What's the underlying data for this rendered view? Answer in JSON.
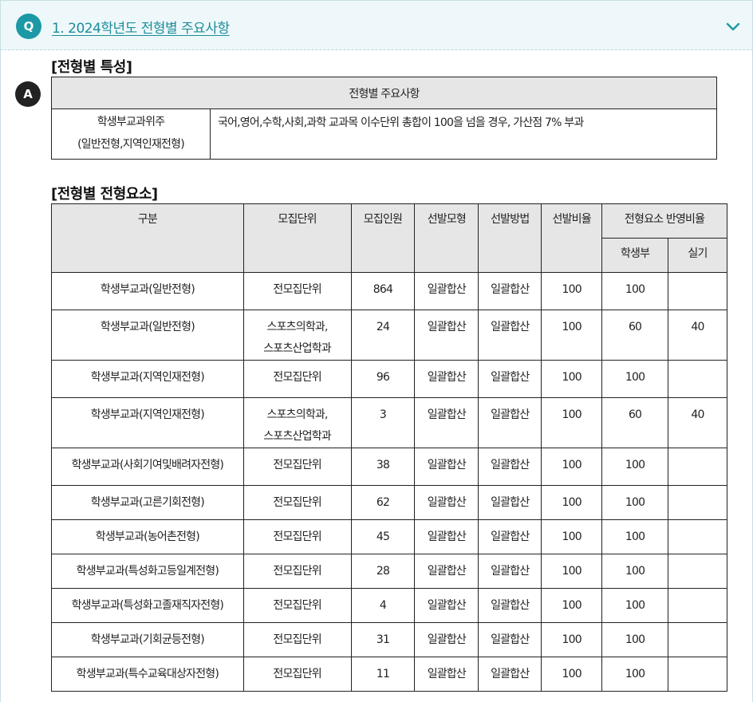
{
  "question": {
    "badge": "Q",
    "title": "1. 2024학년도 전형별 주요사항"
  },
  "answer": {
    "badge": "A"
  },
  "section1": {
    "title": "[전형별 특성]",
    "header": "전형별 주요사항",
    "row": {
      "label_line1": "학생부교과위주",
      "label_line2": "(일반전형,지역인재전형)",
      "content": "국어,영어,수학,사회,과학 교과목 이수단위 총합이 100을 넘을 경우, 가산점 7% 부과"
    }
  },
  "section2": {
    "title": "[전형별 전형요소]",
    "headers": {
      "category": "구분",
      "unit": "모집단위",
      "count": "모집인원",
      "model": "선발모형",
      "method": "선발방법",
      "ratio": "선발비율",
      "reflect": "전형요소 반영비율",
      "record": "학생부",
      "practical": "실기"
    },
    "rows": [
      {
        "category": "학생부교과(일반전형)",
        "unit1": "전모집단위",
        "unit2": "",
        "count": "864",
        "model": "일괄합산",
        "method": "일괄합산",
        "ratio": "100",
        "record": "100",
        "practical": ""
      },
      {
        "category": "학생부교과(일반전형)",
        "unit1": "스포츠의학과,",
        "unit2": "스포츠산업학과",
        "count": "24",
        "model": "일괄합산",
        "method": "일괄합산",
        "ratio": "100",
        "record": "60",
        "practical": "40"
      },
      {
        "category": "학생부교과(지역인재전형)",
        "unit1": "전모집단위",
        "unit2": "",
        "count": "96",
        "model": "일괄합산",
        "method": "일괄합산",
        "ratio": "100",
        "record": "100",
        "practical": ""
      },
      {
        "category": "학생부교과(지역인재전형)",
        "unit1": "스포츠의학과,",
        "unit2": "스포츠산업학과",
        "count": "3",
        "model": "일괄합산",
        "method": "일괄합산",
        "ratio": "100",
        "record": "60",
        "practical": "40"
      },
      {
        "category": "학생부교과(사회기여및배려자전형)",
        "unit1": "전모집단위",
        "unit2": "",
        "count": "38",
        "model": "일괄합산",
        "method": "일괄합산",
        "ratio": "100",
        "record": "100",
        "practical": ""
      },
      {
        "category": "학생부교과(고른기회전형)",
        "unit1": "전모집단위",
        "unit2": "",
        "count": "62",
        "model": "일괄합산",
        "method": "일괄합산",
        "ratio": "100",
        "record": "100",
        "practical": ""
      },
      {
        "category": "학생부교과(농어촌전형)",
        "unit1": "전모집단위",
        "unit2": "",
        "count": "45",
        "model": "일괄합산",
        "method": "일괄합산",
        "ratio": "100",
        "record": "100",
        "practical": ""
      },
      {
        "category": "학생부교과(특성화고등일계전형)",
        "unit1": "전모집단위",
        "unit2": "",
        "count": "28",
        "model": "일괄합산",
        "method": "일괄합산",
        "ratio": "100",
        "record": "100",
        "practical": ""
      },
      {
        "category": "학생부교과(특성화고졸재직자전형)",
        "unit1": "전모집단위",
        "unit2": "",
        "count": "4",
        "model": "일괄합산",
        "method": "일괄합산",
        "ratio": "100",
        "record": "100",
        "practical": ""
      },
      {
        "category": "학생부교과(기회균등전형)",
        "unit1": "전모집단위",
        "unit2": "",
        "count": "31",
        "model": "일괄합산",
        "method": "일괄합산",
        "ratio": "100",
        "record": "100",
        "practical": ""
      },
      {
        "category": "학생부교과(특수교육대상자전형)",
        "unit1": "전모집단위",
        "unit2": "",
        "count": "11",
        "model": "일괄합산",
        "method": "일괄합산",
        "ratio": "100",
        "record": "100",
        "practical": ""
      }
    ]
  },
  "colors": {
    "accent": "#1c98a6",
    "header_bg": "#e6e6e6",
    "question_bg": "#eef8fa"
  },
  "icons": {
    "toggle": "chevron-down-icon"
  }
}
